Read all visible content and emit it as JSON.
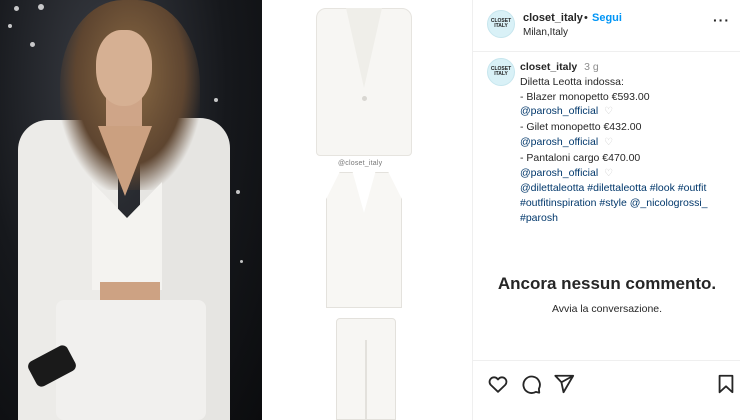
{
  "post": {
    "watermark": "@closet_italy"
  },
  "header": {
    "avatar_text": "CLOSET ITALY",
    "username": "closet_italy",
    "separator": "•",
    "follow_label": "Segui",
    "location": "Milan,Italy",
    "more_label": "···"
  },
  "caption": {
    "username": "closet_italy",
    "time": "3 g",
    "intro": "Diletta Leotta indossa:",
    "items": [
      {
        "text": "- Blazer monopetto €593.00",
        "brand": "@parosh_official"
      },
      {
        "text": "- Gilet monopetto €432.00",
        "brand": "@parosh_official"
      },
      {
        "text": "- Pantaloni cargo €470.00",
        "brand": "@parosh_official"
      }
    ],
    "tags_line1": "@dilettaleotta #dilettaleotta #look #outfit",
    "tags_line2": "#outfitinspiration #style @_nicologrossi_",
    "tags_line3": "#parosh"
  },
  "comments": {
    "empty_title": "Ancora nessun commento.",
    "empty_subtitle": "Avvia la conversazione."
  },
  "icons": [
    "heart-icon",
    "comment-icon",
    "share-icon",
    "bookmark-icon",
    "more-icon"
  ],
  "colors": {
    "link": "#00376b",
    "follow": "#0095f6",
    "text": "#262626",
    "muted": "#8e8e8e"
  }
}
